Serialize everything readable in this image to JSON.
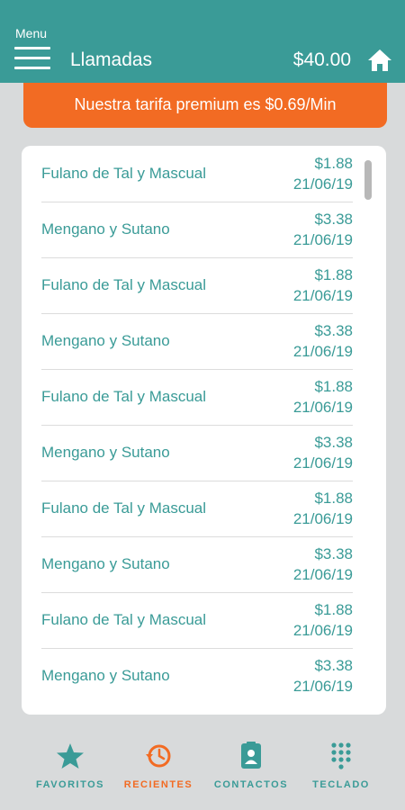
{
  "header": {
    "menu_label": "Menu",
    "title": "Llamadas",
    "balance": "$40.00"
  },
  "promo": {
    "text": "Nuestra tarifa premium es $0.69/Min"
  },
  "calls": [
    {
      "name": "Fulano de Tal y Mascual",
      "amount": "$1.88",
      "date": "21/06/19"
    },
    {
      "name": "Mengano y Sutano",
      "amount": "$3.38",
      "date": "21/06/19"
    },
    {
      "name": "Fulano de Tal y Mascual",
      "amount": "$1.88",
      "date": "21/06/19"
    },
    {
      "name": "Mengano y Sutano",
      "amount": "$3.38",
      "date": "21/06/19"
    },
    {
      "name": "Fulano de Tal y Mascual",
      "amount": "$1.88",
      "date": "21/06/19"
    },
    {
      "name": "Mengano y Sutano",
      "amount": "$3.38",
      "date": "21/06/19"
    },
    {
      "name": "Fulano de Tal y Mascual",
      "amount": "$1.88",
      "date": "21/06/19"
    },
    {
      "name": "Mengano y Sutano",
      "amount": "$3.38",
      "date": "21/06/19"
    },
    {
      "name": "Fulano de Tal y Mascual",
      "amount": "$1.88",
      "date": "21/06/19"
    },
    {
      "name": "Mengano y Sutano",
      "amount": "$3.38",
      "date": "21/06/19"
    }
  ],
  "tabs": {
    "favoritos": "FAVORITOS",
    "recientes": "RECIENTES",
    "contactos": "CONTACTOS",
    "teclado": "TECLADO"
  },
  "colors": {
    "primary": "#3a9b97",
    "accent": "#f26b23"
  },
  "icons": {
    "menu": "hamburger-icon",
    "home": "home-icon",
    "favoritos": "star-icon",
    "recientes": "history-icon",
    "contactos": "contact-card-icon",
    "teclado": "dialpad-icon"
  }
}
